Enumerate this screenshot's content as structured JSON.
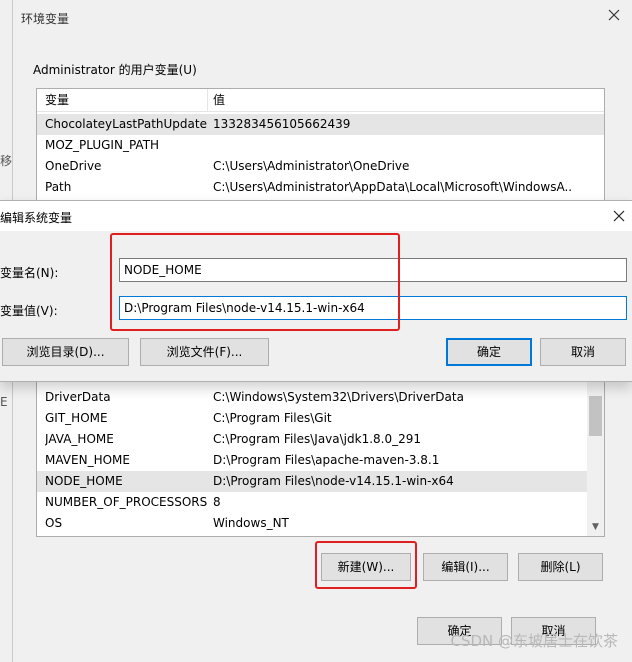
{
  "env_window": {
    "title": "环境变量",
    "user_vars_label": "Administrator 的用户变量(U)",
    "columns": {
      "name": "变量",
      "value": "值"
    },
    "user_vars": [
      {
        "name": "ChocolateyLastPathUpdate",
        "value": "133283456105662439"
      },
      {
        "name": "MOZ_PLUGIN_PATH",
        "value": ""
      },
      {
        "name": "OneDrive",
        "value": "C:\\Users\\Administrator\\OneDrive"
      },
      {
        "name": "Path",
        "value": "C:\\Users\\Administrator\\AppData\\Local\\Microsoft\\WindowsA..."
      }
    ],
    "system_vars": [
      {
        "name": "DriverData",
        "value": "C:\\Windows\\System32\\Drivers\\DriverData"
      },
      {
        "name": "GIT_HOME",
        "value": "C:\\Program Files\\Git"
      },
      {
        "name": "JAVA_HOME",
        "value": "C:\\Program Files\\Java\\jdk1.8.0_291"
      },
      {
        "name": "MAVEN_HOME",
        "value": "D:\\Program Files\\apache-maven-3.8.1"
      },
      {
        "name": "NODE_HOME",
        "value": "D:\\Program Files\\node-v14.15.1-win-x64"
      },
      {
        "name": "NUMBER_OF_PROCESSORS",
        "value": "8"
      },
      {
        "name": "OS",
        "value": "Windows_NT"
      }
    ],
    "buttons": {
      "new": "新建(W)...",
      "edit": "编辑(I)...",
      "delete": "删除(L)",
      "ok": "确定",
      "cancel": "取消"
    },
    "side_fragment_1": "移",
    "side_fragment_2": "E"
  },
  "edit_dialog": {
    "title": "编辑系统变量",
    "name_label": "变量名(N):",
    "value_label": "变量值(V):",
    "name_value": "NODE_HOME",
    "value_value": "D:\\Program Files\\node-v14.15.1-win-x64",
    "buttons": {
      "browse_dir": "浏览目录(D)...",
      "browse_file": "浏览文件(F)...",
      "ok": "确定",
      "cancel": "取消"
    }
  },
  "watermark": "CSDN @东坡居士在饮茶",
  "colors": {
    "highlight": "#e02020",
    "accent": "#0078d7"
  }
}
